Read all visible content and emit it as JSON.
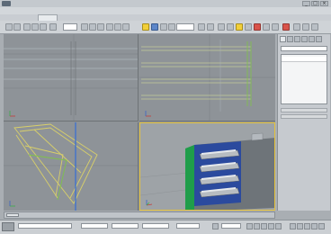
{
  "window": {
    "title": "",
    "minimize": "_",
    "maximize": "□",
    "close": "×"
  },
  "menu": {
    "items": [
      "",
      "",
      "",
      "",
      "",
      "",
      "",
      "",
      "",
      "",
      "",
      "",
      "",
      "",
      "",
      ""
    ]
  },
  "ribbon": {
    "tabs": [
      "",
      "",
      "",
      "",
      "",
      ""
    ],
    "active_tab_index": 1
  },
  "toolbar": {
    "selection_filter_value": "",
    "view_dropdown_value": ""
  },
  "viewports": {
    "top_label": "",
    "front_label": "",
    "left_label": "",
    "perspective_label": "",
    "active": "perspective"
  },
  "command_panel": {
    "object_name": "",
    "selected_item": ""
  },
  "timeline": {
    "frame": ""
  },
  "colors": {
    "active_viewport_border": "#e5c23a",
    "wireframe_green": "#7fc24a",
    "wireframe_yellow": "#d8cf6a",
    "model_green": "#1f9d4a",
    "model_blue": "#2b4a9e",
    "model_grey": "#9aa0a6"
  },
  "icons": {
    "toolbar": [
      "undo-icon",
      "redo-icon",
      "link-icon",
      "unlink-icon",
      "bind-spacewarp-icon",
      "select-object-icon",
      "select-by-name-icon",
      "select-region-icon",
      "window-crossing-icon",
      "select-move-icon",
      "select-rotate-icon",
      "select-scale-icon",
      "pivot-icon",
      "keyboard-shortcut-icon",
      "snap-toggle-icon",
      "angle-snap-icon",
      "percent-snap-icon",
      "spinner-snap-icon",
      "named-selection-icon",
      "mirror-icon",
      "align-icon",
      "layer-manager-icon",
      "graphite-tools-icon",
      "curve-editor-icon",
      "schematic-view-icon",
      "material-editor-icon",
      "render-setup-icon",
      "rendered-frame-icon",
      "render-icon"
    ]
  }
}
